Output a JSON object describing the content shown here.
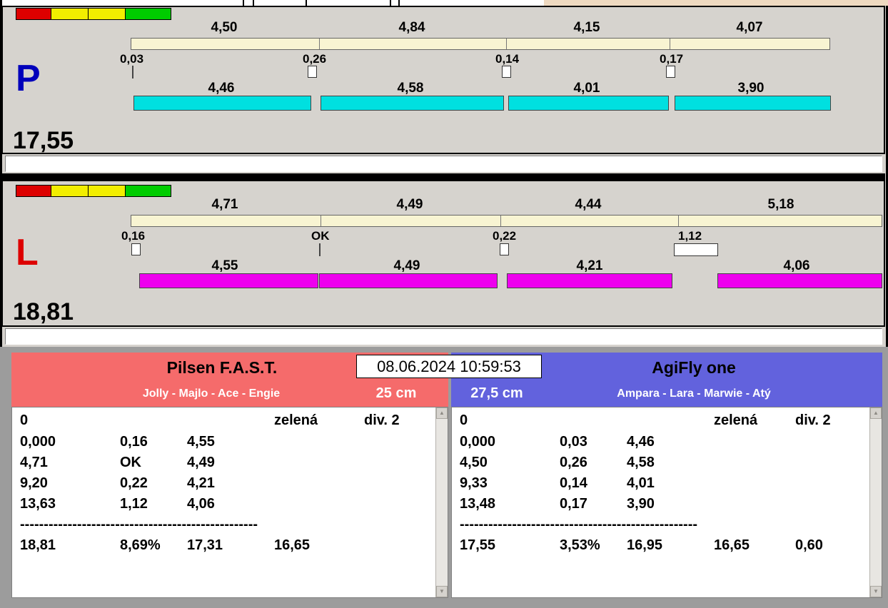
{
  "icons": {
    "scroll_up": "▲",
    "scroll_down": "▼"
  },
  "timestamp": "08.06.2024 10:59:53",
  "lanes": {
    "p": {
      "label": "P",
      "total": "17,55",
      "splits": [
        "4,50",
        "4,84",
        "4,15",
        "4,07"
      ],
      "changeovers": [
        "0,03",
        "0,26",
        "0,14",
        "0,17"
      ],
      "dog_times": [
        "4,46",
        "4,58",
        "4,01",
        "3,90"
      ]
    },
    "l": {
      "label": "L",
      "total": "18,81",
      "splits": [
        "4,71",
        "4,49",
        "4,44",
        "5,18"
      ],
      "changeovers": [
        "0,16",
        "OK",
        "0,22",
        "1,12"
      ],
      "dog_times": [
        "4,55",
        "4,49",
        "4,21",
        "4,06"
      ]
    }
  },
  "teams": {
    "left": {
      "name": "Pilsen F.A.S.T.",
      "dogs": "Jolly - Majlo - Ace - Engie",
      "height": "25 cm",
      "status": {
        "penalty": "0",
        "light": "zelená",
        "division": "div. 2"
      },
      "rows": [
        [
          "0,000",
          "0,16",
          "4,55"
        ],
        [
          "4,71",
          "OK",
          "4,49"
        ],
        [
          "9,20",
          "0,22",
          "4,21"
        ],
        [
          "13,63",
          "1,12",
          "4,06"
        ]
      ],
      "separator": "--------------------------------------------------",
      "summary": [
        "18,81",
        "8,69%",
        "17,31",
        "16,65"
      ]
    },
    "right": {
      "name": "AgiFly one",
      "dogs": "Ampara - Lara - Marwie - Atý",
      "height": "27,5 cm",
      "status": {
        "penalty": "0",
        "light": "zelená",
        "division": "div. 2"
      },
      "rows": [
        [
          "0,000",
          "0,03",
          "4,46"
        ],
        [
          "4,50",
          "0,26",
          "4,58"
        ],
        [
          "9,33",
          "0,14",
          "4,01"
        ],
        [
          "13,48",
          "0,17",
          "3,90"
        ]
      ],
      "separator": "--------------------------------------------------",
      "summary": [
        "17,55",
        "3,53%",
        "16,95",
        "16,65",
        "0,60"
      ]
    }
  },
  "colors": {
    "background": "#d6d3ce",
    "lane_p_letter": "#0000bb",
    "lane_l_letter": "#dd0000",
    "split_bar": "#f8f4d2",
    "p_dog_bar": "#00e0e0",
    "l_dog_bar": "#ee00ee",
    "traffic_lights": [
      "#dd0000",
      "#f2ee00",
      "#f2ee00",
      "#00cc00"
    ],
    "team_left_header": "#f56b6b",
    "team_right_header": "#6262dd",
    "divider": "#000000"
  }
}
